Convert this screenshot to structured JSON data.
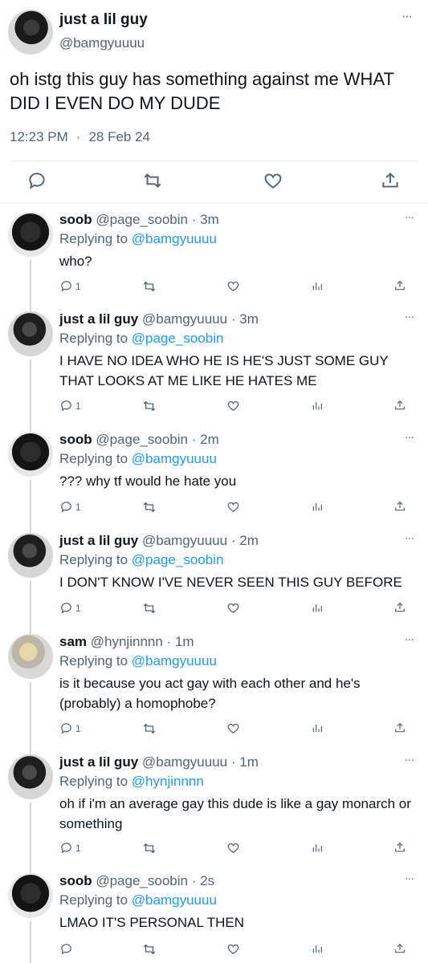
{
  "main_tweet": {
    "display_name": "just a lil guy",
    "handle": "@bamgyuuuu",
    "text": "oh istg this guy has something against me WHAT DID I EVEN DO MY DUDE",
    "time": "12:23 PM",
    "date": "28 Feb 24",
    "more_label": "···"
  },
  "replies": [
    {
      "name": "soob",
      "handle": "@page_soobin",
      "sep": "·",
      "time": "3m",
      "replying_prefix": "Replying to",
      "replying_to": "@bamgyuuuu",
      "text": "who?",
      "reply_count": "1"
    },
    {
      "name": "just a lil guy",
      "handle": "@bamgyuuuu",
      "sep": "·",
      "time": "3m",
      "replying_prefix": "Replying to",
      "replying_to": "@page_soobin",
      "text": "I HAVE NO IDEA WHO HE IS HE'S JUST SOME GUY THAT LOOKS AT ME LIKE HE HATES ME",
      "reply_count": "1"
    },
    {
      "name": "soob",
      "handle": "@page_soobin",
      "sep": "·",
      "time": "2m",
      "replying_prefix": "Replying to",
      "replying_to": "@bamgyuuuu",
      "text": "??? why tf would he hate you",
      "reply_count": "1"
    },
    {
      "name": "just a lil guy",
      "handle": "@bamgyuuuu",
      "sep": "·",
      "time": "2m",
      "replying_prefix": "Replying to",
      "replying_to": "@page_soobin",
      "text": "I DON'T KNOW I'VE NEVER SEEN THIS GUY BEFORE",
      "reply_count": "1"
    },
    {
      "name": "sam",
      "handle": "@hynjinnnn",
      "sep": "·",
      "time": "1m",
      "replying_prefix": "Replying to",
      "replying_to": "@bamgyuuuu",
      "text": "is it because you act gay with each other and he's (probably) a homophobe?",
      "reply_count": "1"
    },
    {
      "name": "just a lil guy",
      "handle": "@bamgyuuuu",
      "sep": "·",
      "time": "1m",
      "replying_prefix": "Replying to",
      "replying_to": "@hynjinnnn",
      "text": "oh if i'm an average gay this dude is like a gay monarch or something",
      "reply_count": "1"
    },
    {
      "name": "soob",
      "handle": "@page_soobin",
      "sep": "·",
      "time": "2s",
      "replying_prefix": "Replying to",
      "replying_to": "@bamgyuuuu",
      "text": "LMAO IT'S PERSONAL THEN",
      "reply_count": ""
    }
  ],
  "more_label": "···"
}
